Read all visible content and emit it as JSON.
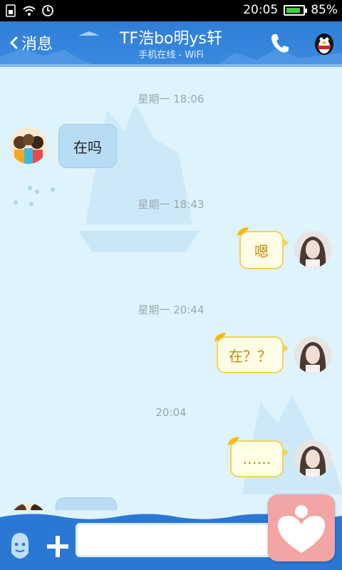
{
  "status_bar": {
    "time": "20:05",
    "battery_percent": "85%",
    "battery_level": 0.85,
    "icons": [
      "sim-icon",
      "wifi-icon",
      "clock-icon",
      "battery-icon"
    ]
  },
  "header": {
    "back_label": "消息",
    "title": "TF浩bo明ys轩",
    "subtitle": "手机在线 - WiFi",
    "icons": [
      "back-arrow-icon",
      "phone-icon",
      "penguin-icon"
    ]
  },
  "chat": {
    "timestamps": [
      "星期一 18:06",
      "星期一 18:43",
      "星期一 20:44",
      "20:04"
    ],
    "messages": [
      {
        "side": "left",
        "text": "在吗"
      },
      {
        "side": "right",
        "text": "嗯"
      },
      {
        "side": "right",
        "text": "在？？"
      },
      {
        "side": "right",
        "text": "……"
      }
    ]
  },
  "input_bar": {
    "input_value": "",
    "icons": [
      "emoji-icon",
      "plus-icon",
      "heart-icon"
    ]
  },
  "colors": {
    "header_blue": "#2e7ed9",
    "chat_bg": "#def3fb",
    "left_bubble": "#b8dcf4",
    "right_bubble": "#fffde6",
    "right_bubble_border": "#f3d25b",
    "heart_button": "#f3a4a4"
  }
}
